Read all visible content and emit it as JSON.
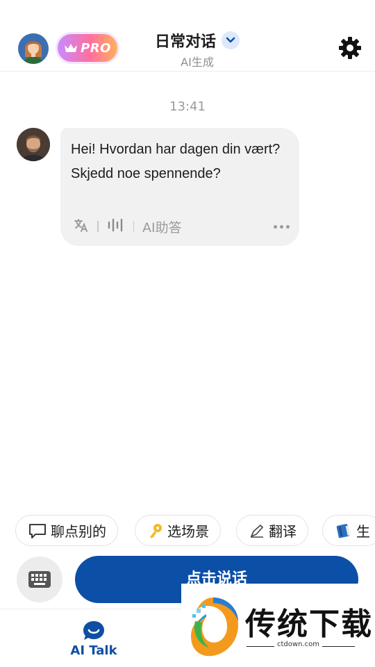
{
  "header": {
    "pro_label": "PRO",
    "title": "日常对话",
    "subtitle": "AI生成"
  },
  "chat": {
    "timestamp": "13:41",
    "message": "Hei! Hvordan har dagen din vært? Skjedd noe spennende?",
    "tools": {
      "ai_helper": "AI助答"
    }
  },
  "chips": [
    {
      "label": "聊点别的",
      "icon": "speech-bubble-icon"
    },
    {
      "label": "选场景",
      "icon": "key-icon"
    },
    {
      "label": "翻译",
      "icon": "pen-icon"
    },
    {
      "label": "生",
      "icon": "book-icon"
    }
  ],
  "input": {
    "talk_label": "点击说话"
  },
  "nav": {
    "ai_talk_label": "AI Talk"
  },
  "watermark": {
    "brand": "传统下载",
    "url": "ctdown.com"
  },
  "colors": {
    "accent": "#0c4fa6",
    "bubble": "#f1f1f1",
    "pro_gradient_start": "#c78bff",
    "pro_gradient_end": "#ffb25c"
  }
}
